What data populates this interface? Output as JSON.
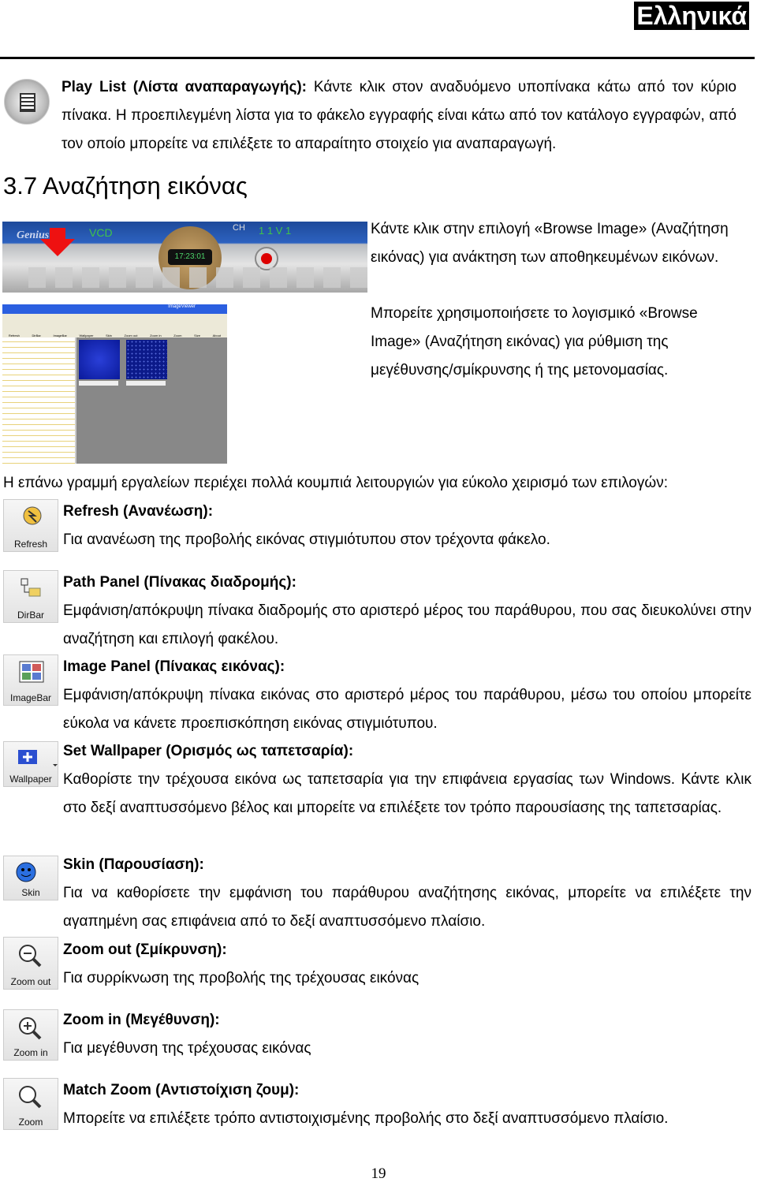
{
  "header": {
    "language": "Ελληνικά"
  },
  "playlist": {
    "title": "Play List (Λίστα αναπαραγωγής):",
    "text": " Κάντε κλικ στον αναδυόμενο υποπίνακα κάτω από τον κύριο πίνακα. Η προεπιλεγμένη λίστα για το φάκελο εγγραφής είναι κάτω από τον κατάλογο εγγραφών, από τον οποίο μπορείτε να επιλέξετε το απαραίτητο στοιχείο για αναπαραγωγή.",
    "icon": "playlist-icon"
  },
  "section": {
    "heading": "3.7 Αναζήτηση εικόνας"
  },
  "player": {
    "brand": "Genius",
    "mode": "VCD",
    "channel": "CH",
    "display": "1 1 V 1",
    "time": "17:23:01"
  },
  "browse_text1": "Κάντε κλικ στην επιλογή «Browse Image» (Αναζήτηση εικόνας) για ανάκτηση των αποθηκευμένων εικόνων.",
  "browse_text2": "Μπορείτε χρησιμοποιήσετε το λογισμικό «Browse Image» (Αναζήτηση εικόνας) για ρύθμιση της μεγέθυνσης/σμίκρυνσης ή της μετονομασίας.",
  "browser": {
    "title": "ImageViewer",
    "toolbar": [
      "Refresh",
      "DirBar",
      "ImageBar",
      "Wallpaper",
      "Skin",
      "Zoom out",
      "Zoom in",
      "Zoom",
      "Size",
      "About"
    ]
  },
  "toolbar_intro": "Η επάνω γραμμή εργαλείων περιέχει πολλά κουμπιά λειτουργιών για εύκολο χειρισμό των επιλογών:",
  "items": [
    {
      "label": "Refresh",
      "title": "Refresh (Ανανέωση):",
      "text": "Για ανανέωση της προβολής εικόνας στιγμιότυπου στον τρέχοντα φάκελο."
    },
    {
      "label": "DirBar",
      "title": "Path Panel (Πίνακας διαδρομής):",
      "text": "Εμφάνιση/απόκρυψη πίνακα διαδρομής στο αριστερό μέρος του παράθυρου, που σας διευκολύνει στην αναζήτηση και επιλογή φακέλου."
    },
    {
      "label": "ImageBar",
      "title": "Image Panel (Πίνακας εικόνας):",
      "text": "Εμφάνιση/απόκρυψη πίνακα εικόνας στο αριστερό μέρος του παράθυρου, μέσω του οποίου μπορείτε εύκολα να κάνετε προεπισκόπηση εικόνας στιγμιότυπου."
    },
    {
      "label": "Wallpaper",
      "title": "Set Wallpaper (Ορισμός ως ταπετσαρία):",
      "text": "Καθορίστε την τρέχουσα εικόνα ως ταπετσαρία για την επιφάνεια εργασίας των Windows. Κάντε κλικ στο δεξί αναπτυσσόμενο βέλος και μπορείτε να επιλέξετε τον τρόπο παρουσίασης της ταπετσαρίας."
    },
    {
      "label": "Skin",
      "title": "Skin (Παρουσίαση):",
      "text": "Για να καθορίσετε την εμφάνιση του παράθυρου αναζήτησης εικόνας, μπορείτε να επιλέξετε την αγαπημένη σας επιφάνεια από το δεξί αναπτυσσόμενο πλαίσιο."
    },
    {
      "label": "Zoom out",
      "title": "Zoom out (Σμίκρυνση):",
      "text": "Για συρρίκνωση της προβολής της τρέχουσας εικόνας"
    },
    {
      "label": "Zoom in",
      "title": "Zoom in (Μεγέθυνση):",
      "text": "Για μεγέθυνση της τρέχουσας εικόνας"
    },
    {
      "label": "Zoom",
      "title": "Match Zoom (Αντιστοίχιση ζουμ):",
      "text": "Μπορείτε να επιλέξετε τρόπο αντιστοιχισμένης προβολής στο δεξί αναπτυσσόμενο πλαίσιο."
    }
  ],
  "page_number": "19"
}
